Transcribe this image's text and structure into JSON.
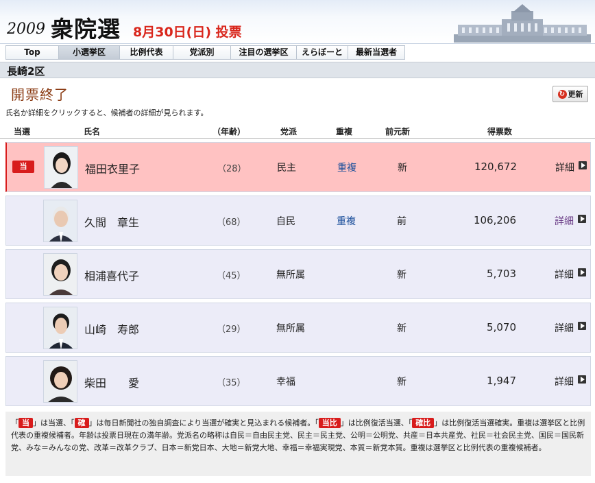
{
  "header": {
    "year": "2009",
    "title": "衆院選",
    "vote_date": "8月30日(日) 投票"
  },
  "nav": {
    "tabs": [
      {
        "label": "Top",
        "active": false
      },
      {
        "label": "小選挙区",
        "active": true
      },
      {
        "label": "比例代表",
        "active": false
      },
      {
        "label": "党派別",
        "active": false
      },
      {
        "label": "注目の選挙区",
        "active": false
      },
      {
        "label": "えらぼーと",
        "active": false
      },
      {
        "label": "最新当選者",
        "active": false
      }
    ]
  },
  "district": "長崎2区",
  "status": "開票終了",
  "refresh_label": "更新",
  "instruction": "氏名か詳細をクリックすると、候補者の詳細が見られます。",
  "columns": {
    "elected": "当選",
    "name": "氏名",
    "age": "（年齢）",
    "party": "党派",
    "dual": "重複",
    "status": "前元新",
    "votes": "得票数"
  },
  "candidates": [
    {
      "badge": "当",
      "name": "福田衣里子",
      "age": "（28）",
      "party": "民主",
      "dual": "重複",
      "status": "新",
      "votes": "120,672",
      "detail": "詳細",
      "elected": true
    },
    {
      "badge": "",
      "name": "久間　章生",
      "age": "（68）",
      "party": "自民",
      "dual": "重複",
      "status": "前",
      "votes": "106,206",
      "detail": "詳細",
      "elected": false
    },
    {
      "badge": "",
      "name": "相浦喜代子",
      "age": "（45）",
      "party": "無所属",
      "dual": "",
      "status": "新",
      "votes": "5,703",
      "detail": "詳細",
      "elected": false
    },
    {
      "badge": "",
      "name": "山崎　寿郎",
      "age": "（29）",
      "party": "無所属",
      "dual": "",
      "status": "新",
      "votes": "5,070",
      "detail": "詳細",
      "elected": false
    },
    {
      "badge": "",
      "name": "柴田　　愛",
      "age": "（35）",
      "party": "幸福",
      "dual": "",
      "status": "新",
      "votes": "1,947",
      "detail": "詳細",
      "elected": false
    }
  ],
  "legend": {
    "tag1": "当",
    "text1": "」は当選、「",
    "tag2": "確",
    "text2": "」は毎日新聞社の独自調査により当選が確実と見込まれる候補者。「",
    "tag3": "当比",
    "text3": "」は比例復活当選、「",
    "tag4": "確比",
    "text4": "」は比例復活当選確実。重複は選挙区と比例代表の重複候補者。年齢は投票日現在の満年齢。党派名の略称は自民＝自由民主党、民主＝民主党、公明＝公明党、共産＝日本共産党、社民＝社会民主党、国民＝国民新党、みな＝みんなの党、改革＝改革クラブ、日本＝新党日本、大地＝新党大地、幸福＝幸福実現党、本質＝新党本質。重複は選挙区と比例代表の重複候補者。"
  },
  "colors": {
    "elected_row": "#ffc2c2",
    "other_row": "#ececf8",
    "badge": "#d81c1c",
    "status_text": "#8a3a12",
    "date_text": "#d9261c"
  }
}
